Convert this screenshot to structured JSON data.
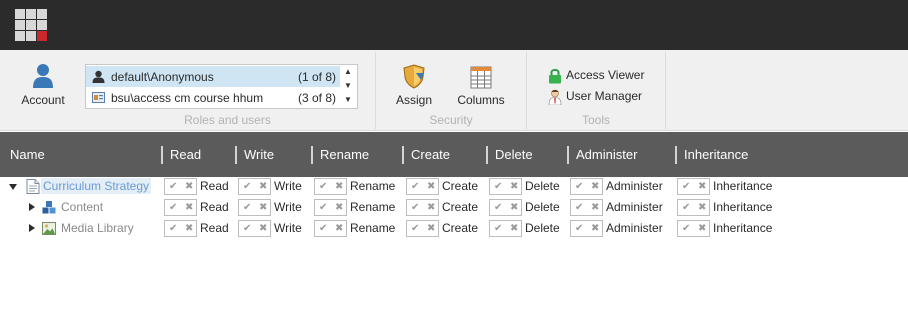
{
  "colors": {
    "topbar": "#2b2b2b",
    "logo_accent": "#c9282d",
    "header_bg": "#5b5b5b",
    "selection": "#cfe5f4",
    "link": "#6b9bd1"
  },
  "ribbon": {
    "account": {
      "label": "Account",
      "icon": "user-icon"
    },
    "roles_users": {
      "group_label": "Roles and users",
      "items": [
        {
          "name": "default\\Anonymous",
          "count": "(1 of 8)",
          "icon": "user-silhouette-icon",
          "selected": true
        },
        {
          "name": "bsu\\access cm course hhum",
          "count": "(3 of 8)",
          "icon": "role-card-icon",
          "selected": false
        }
      ],
      "scroll_up": "▲",
      "scroll_mid": "▼",
      "scroll_down": "▼"
    },
    "security": {
      "group_label": "Security",
      "assign": {
        "label": "Assign",
        "icon": "shield-icon"
      },
      "columns": {
        "label": "Columns",
        "icon": "columns-grid-icon"
      }
    },
    "tools": {
      "group_label": "Tools",
      "access_viewer": {
        "label": "Access Viewer",
        "icon": "lock-icon"
      },
      "user_manager": {
        "label": "User Manager",
        "icon": "user-manager-icon"
      }
    }
  },
  "table": {
    "columns": [
      "Name",
      "Read",
      "Write",
      "Rename",
      "Create",
      "Delete",
      "Administer",
      "Inheritance"
    ],
    "rows": [
      {
        "name": "Curriculum Strategy",
        "icon": "document-icon",
        "expander": "expanded",
        "perms": [
          "Read",
          "Write",
          "Rename",
          "Create",
          "Delete",
          "Administer",
          "Inheritance"
        ]
      },
      {
        "name": "Content",
        "icon": "content-cubes-icon",
        "expander": "collapsed",
        "perms": [
          "Read",
          "Write",
          "Rename",
          "Create",
          "Delete",
          "Administer",
          "Inheritance"
        ]
      },
      {
        "name": "Media Library",
        "icon": "image-icon",
        "expander": "collapsed",
        "perms": [
          "Read",
          "Write",
          "Rename",
          "Create",
          "Delete",
          "Administer",
          "Inheritance"
        ]
      }
    ],
    "allow_glyph": "✔",
    "deny_glyph": "✖"
  }
}
